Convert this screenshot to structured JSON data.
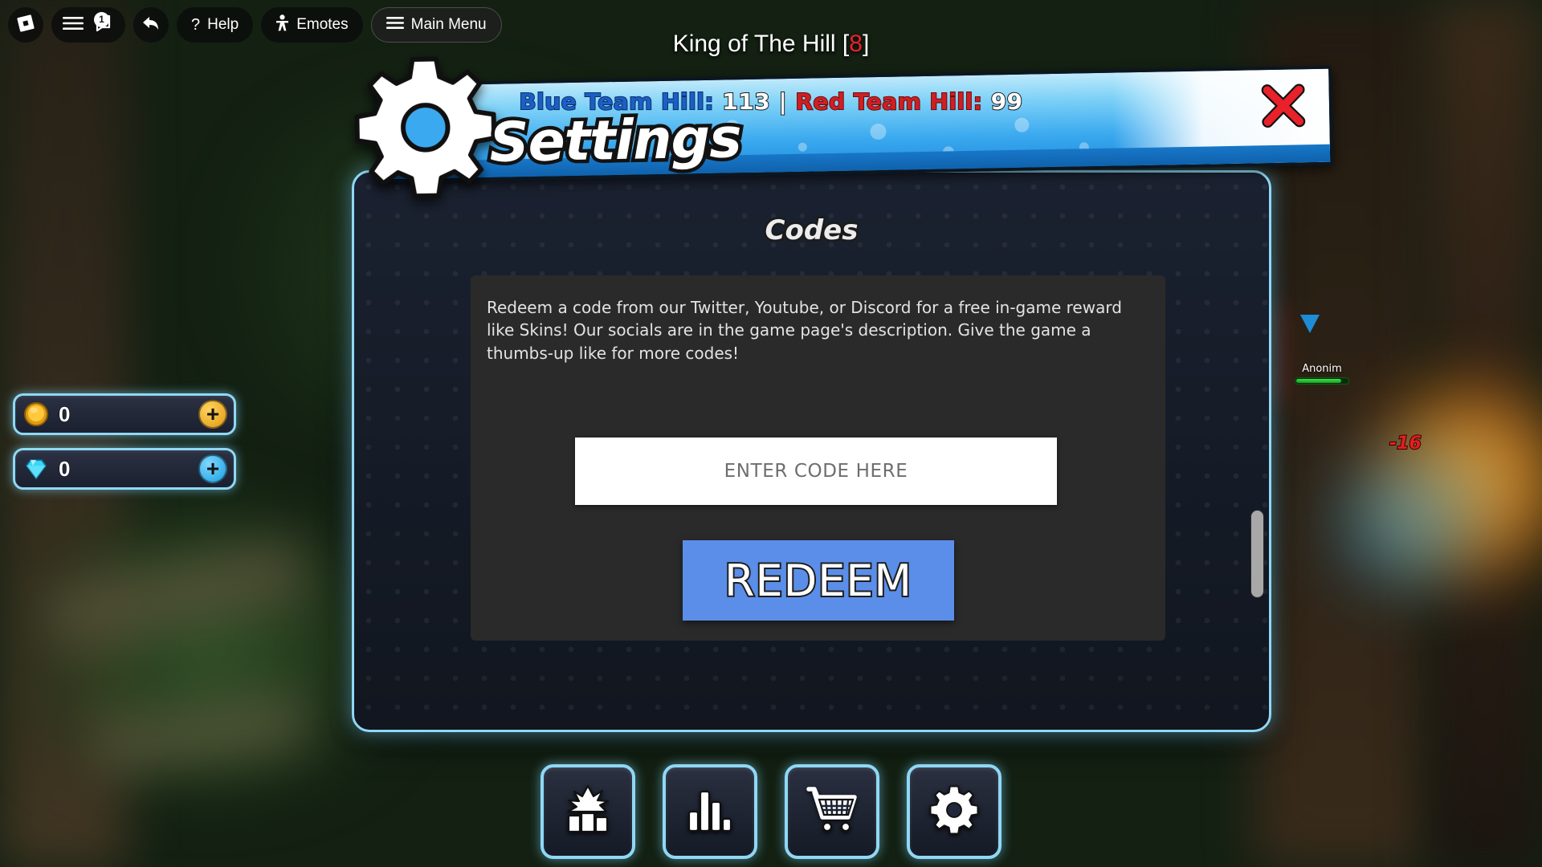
{
  "roblox_topbar": {
    "logo_icon": "roblox-logo-icon",
    "menu_icon": "hamburger-menu-icon",
    "chat_icon": "chat-icon",
    "chat_badge": "1",
    "back_icon": "back-arrow-icon",
    "help_label": "Help",
    "help_icon": "question-mark-icon",
    "emotes_label": "Emotes",
    "emotes_icon": "person-emote-icon",
    "main_menu_label": "Main Menu",
    "main_menu_icon": "hamburger-menu-icon"
  },
  "match_header": {
    "title": "King of The Hill",
    "bracket_open": "[",
    "count": "8",
    "bracket_close": "]",
    "blue_label": "Blue Team Hill:",
    "blue_score": "113",
    "separator": "|",
    "red_label": "Red Team Hill:",
    "red_score": "99"
  },
  "settings_window": {
    "banner_title": "Settings",
    "gear_icon": "gear-icon",
    "close_icon": "close-x-icon",
    "panel_title": "Codes",
    "description": "Redeem a code from our Twitter, Youtube, or Discord for a free in-game reward like Skins! Our socials are in the game page's description. Give the game a thumbs-up like for more codes!",
    "code_placeholder": "ENTER CODE HERE",
    "code_value": "",
    "redeem_label": "REDEEM",
    "accent_color": "#8fd8f5",
    "redeem_color": "#5b8ee8",
    "close_color": "#e8212a"
  },
  "currency": [
    {
      "name": "coins",
      "icon": "gold-coin-icon",
      "value": "0",
      "add_label": "+"
    },
    {
      "name": "gems",
      "icon": "blue-gem-icon",
      "value": "0",
      "add_label": "+"
    }
  ],
  "bottom_nav": [
    {
      "name": "skins",
      "icon": "character-skins-icon"
    },
    {
      "name": "leaderboard",
      "icon": "bar-chart-icon"
    },
    {
      "name": "shop",
      "icon": "shopping-cart-icon"
    },
    {
      "name": "settings",
      "icon": "gear-icon"
    }
  ],
  "world_hud": {
    "player_name": "Anonim",
    "team_arrow_icon": "blue-team-arrow-icon",
    "damage_number": "-16",
    "health_color": "#2ecb3a"
  }
}
